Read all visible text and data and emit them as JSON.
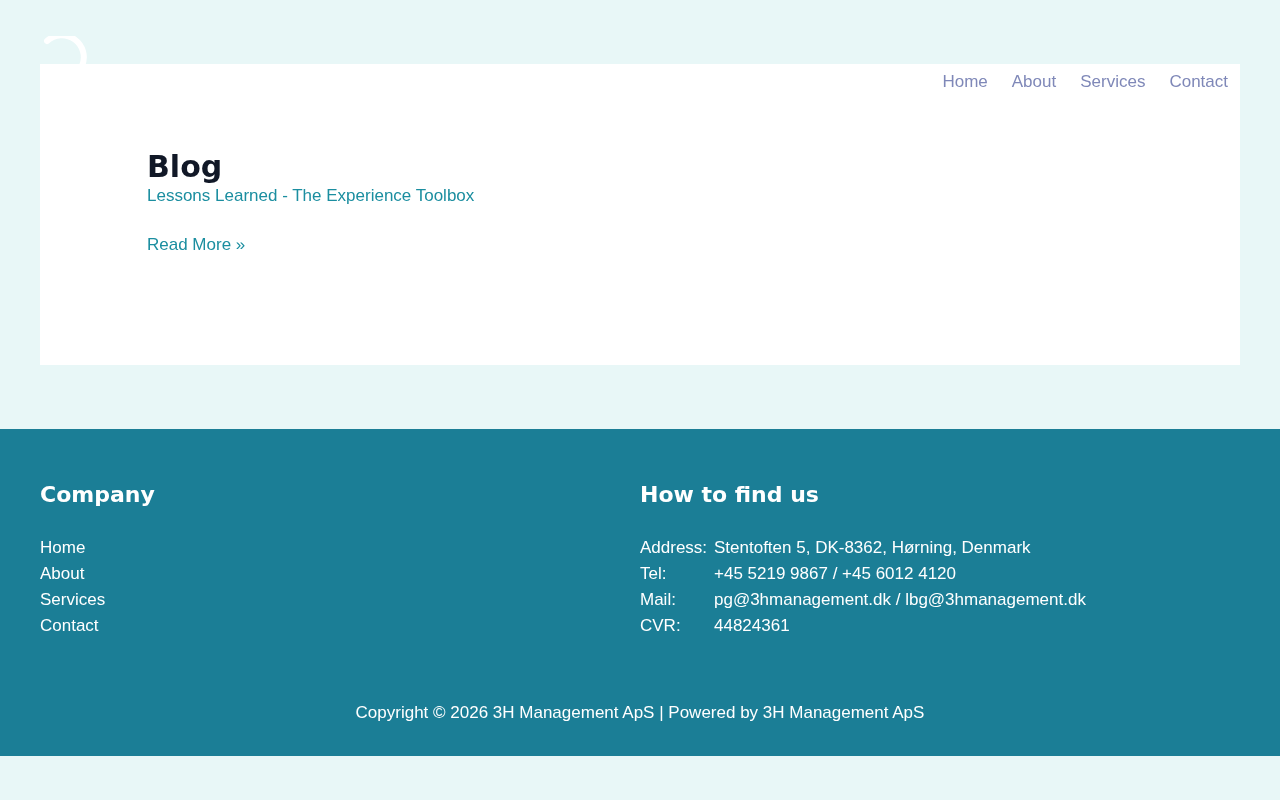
{
  "header": {
    "nav": [
      {
        "label": "Home"
      },
      {
        "label": "About"
      },
      {
        "label": "Services"
      },
      {
        "label": "Contact"
      }
    ]
  },
  "main": {
    "title": "Blog",
    "post": {
      "title": "Lessons Learned - The Experience Toolbox",
      "read_more": "Read More »"
    }
  },
  "footer": {
    "company": {
      "heading": "Company",
      "links": [
        "Home",
        "About",
        "Services",
        "Contact"
      ]
    },
    "contact": {
      "heading": "How to find us",
      "rows": [
        {
          "label": "Address:",
          "value": "Stentoften 5, DK-8362, Hørning, Denmark"
        },
        {
          "label": "Tel:",
          "value": "+45 5219 9867 / +45 6012 4120"
        },
        {
          "label": "Mail:",
          "value": "pg@3hmanagement.dk / lbg@3hmanagement.dk"
        },
        {
          "label": "CVR:",
          "value": "44824361"
        }
      ]
    },
    "copyright": "Copyright © 2026 3H Management ApS | Powered by 3H Management ApS"
  }
}
